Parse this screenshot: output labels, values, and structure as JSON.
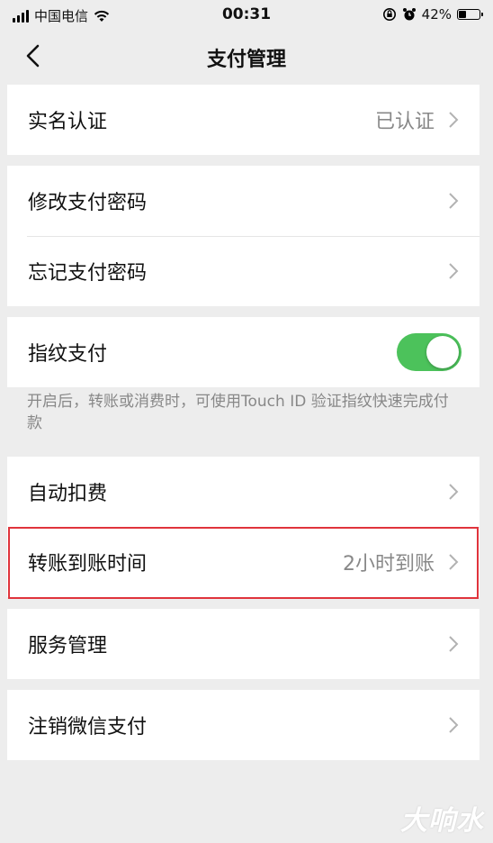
{
  "status_bar": {
    "carrier": "中国电信",
    "time": "00:31",
    "battery": "42%",
    "battery_level": 0.42,
    "icons": [
      "signal-icon",
      "wifi-icon",
      "rotation-lock-icon",
      "alarm-icon",
      "battery-icon"
    ]
  },
  "nav": {
    "title": "支付管理",
    "back_icon": "chevron-left-icon"
  },
  "groups": {
    "real_name": {
      "label": "实名认证",
      "value": "已认证"
    },
    "password": {
      "change_label": "修改支付密码",
      "forgot_label": "忘记支付密码"
    },
    "fingerprint": {
      "label": "指纹支付",
      "enabled": true,
      "hint": "开启后，转账或消费时，可使用Touch ID 验证指纹快速完成付款"
    },
    "auto": {
      "auto_deduct_label": "自动扣费",
      "transfer_time_label": "转账到账时间",
      "transfer_time_value": "2小时到账"
    },
    "service": {
      "label": "服务管理"
    },
    "close": {
      "label": "注销微信支付"
    }
  },
  "colors": {
    "toggle_on": "#4cc25b",
    "highlight_border": "#e0343c",
    "background": "#ededed"
  },
  "watermark": "大响水"
}
